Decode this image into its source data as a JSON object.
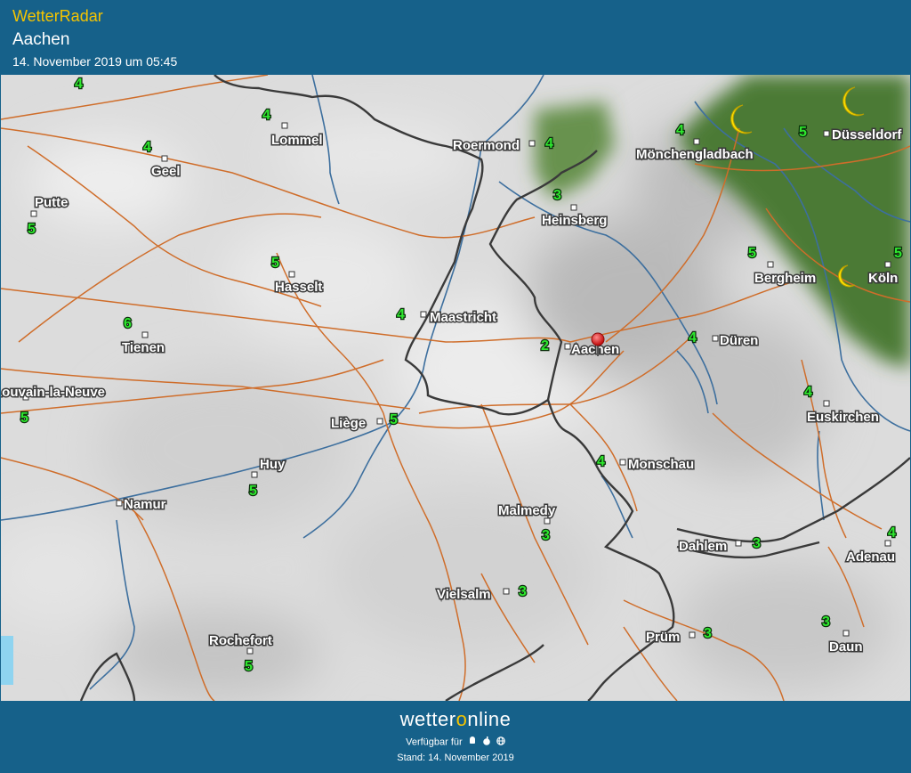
{
  "header": {
    "app_title": "WetterRadar",
    "place": "Aachen",
    "timestamp": "14. November 2019 um 05:45"
  },
  "footer": {
    "brand_pre": "wetter",
    "brand_o": "o",
    "brand_post": "nline",
    "available_label": "Verfügbar für",
    "platform_icons": [
      "android-icon",
      "apple-icon",
      "web-icon"
    ],
    "stand": "Stand: 14. November 2019"
  },
  "colors": {
    "header_bg": "#16618a",
    "app_title": "#f5c400",
    "number_green": "#2ee82e",
    "road": "#cf6d2a",
    "river": "#3d6f9e",
    "border": "#3a3a3a",
    "precip_green": "#4c7a34",
    "marker_red": "#e01b1b"
  },
  "map": {
    "marker": "Aachen",
    "cities": [
      "Lommel",
      "Geel",
      "Putte",
      "Hasselt",
      "Tienen",
      "Louvain-la-Neuve",
      "Roermond",
      "Mönchengladbach",
      "Düsseldorf",
      "Heinsberg",
      "Maastricht",
      "Aachen",
      "Bergheim",
      "Köln",
      "Düren",
      "Liège",
      "Huy",
      "Namur",
      "Euskirchen",
      "Monschau",
      "Malmedy",
      "Dahlem",
      "Adenau",
      "Vielsalm",
      "Prüm",
      "Rochefort",
      "Daun"
    ],
    "numbers": [
      "4",
      "4",
      "4",
      "5",
      "5",
      "6",
      "5",
      "4",
      "5",
      "4",
      "4",
      "3",
      "5",
      "5",
      "2",
      "4",
      "5",
      "5",
      "4",
      "4",
      "3",
      "3",
      "4",
      "3",
      "3",
      "3",
      "5"
    ],
    "moons": [
      "moon-icon",
      "moon-icon",
      "moon-icon"
    ]
  }
}
